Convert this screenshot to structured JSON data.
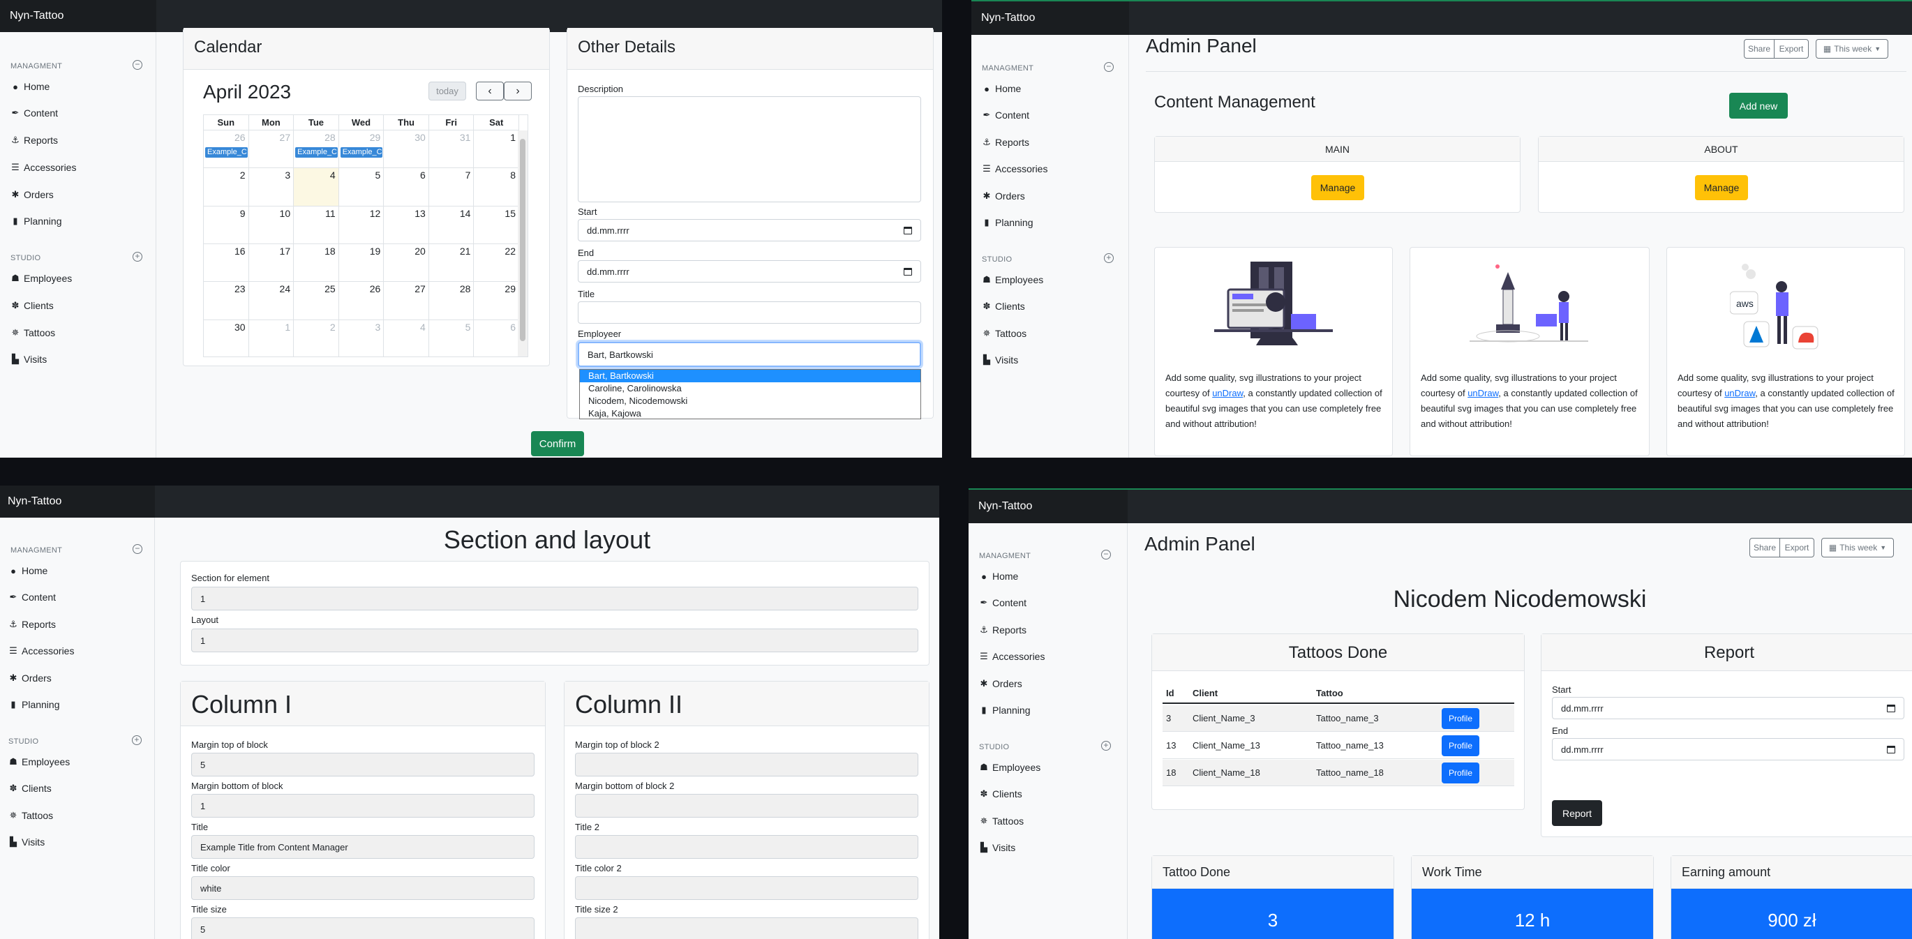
{
  "brand": "Nyn-Tattoo",
  "sidebar": {
    "section1": "MANAGMENT",
    "section2": "STUDIO",
    "items1": [
      {
        "label": "Home",
        "icon": "circle-icon"
      },
      {
        "label": "Content",
        "icon": "feather-icon"
      },
      {
        "label": "Reports",
        "icon": "anchor-icon"
      },
      {
        "label": "Accessories",
        "icon": "list-icon"
      },
      {
        "label": "Orders",
        "icon": "gear-icon"
      },
      {
        "label": "Planning",
        "icon": "book-icon"
      }
    ],
    "items2": [
      {
        "label": "Employees",
        "icon": "people-icon"
      },
      {
        "label": "Clients",
        "icon": "asterisk-icon"
      },
      {
        "label": "Tattoos",
        "icon": "spider-icon"
      },
      {
        "label": "Visits",
        "icon": "door-icon"
      }
    ]
  },
  "p1": {
    "calendar_title": "Calendar",
    "month": "April 2023",
    "today": "today",
    "days": [
      "Sun",
      "Mon",
      "Tue",
      "Wed",
      "Thu",
      "Fri",
      "Sat"
    ],
    "weeks": [
      [
        "26",
        "27",
        "28",
        "29",
        "30",
        "31",
        "1"
      ],
      [
        "2",
        "3",
        "4",
        "5",
        "6",
        "7",
        "8"
      ],
      [
        "9",
        "10",
        "11",
        "12",
        "13",
        "14",
        "15"
      ],
      [
        "16",
        "17",
        "18",
        "19",
        "20",
        "21",
        "22"
      ],
      [
        "23",
        "24",
        "25",
        "26",
        "27",
        "28",
        "29"
      ],
      [
        "30",
        "1",
        "2",
        "3",
        "4",
        "5",
        "6"
      ]
    ],
    "event": "Example_C",
    "details_title": "Other Details",
    "description": "Description",
    "start": "Start",
    "end": "End",
    "date_placeholder": "dd.mm.rrrr",
    "title": "Title",
    "employeer": "Employeer",
    "selected": "Bart, Bartkowski",
    "options": [
      "Bart, Bartkowski",
      "Caroline, Carolinowska",
      "Nicodem, Nicodemowski",
      "Kaja, Kajowa"
    ],
    "confirm": "Confirm"
  },
  "p2": {
    "title": "Admin Panel",
    "share": "Share",
    "export": "Export",
    "week": "This week",
    "cm": "Content Management",
    "add": "Add new",
    "main": "MAIN",
    "about": "ABOUT",
    "manage": "Manage",
    "card_pre": "Add some quality, svg illustrations to your project courtesy of ",
    "card_link": "unDraw",
    "card_post": ", a constantly updated collection of beautiful svg images that you can use completely free and without attribution!",
    "aws": "aws"
  },
  "p3": {
    "title": "Section and layout",
    "section_label": "Section for element",
    "section_val": "1",
    "layout_label": "Layout",
    "layout_val": "1",
    "col1": "Column I",
    "col2": "Column II",
    "c1": [
      {
        "l": "Margin top of block",
        "v": "5"
      },
      {
        "l": "Margin bottom of block",
        "v": "1"
      },
      {
        "l": "Title",
        "v": "Example Title from Content Manager"
      },
      {
        "l": "Title color",
        "v": "white"
      },
      {
        "l": "Title size",
        "v": "5"
      }
    ],
    "c2": [
      "Margin top of block 2",
      "Margin bottom of block 2",
      "Title 2",
      "Title color 2",
      "Title size 2"
    ]
  },
  "p4": {
    "title": "Admin Panel",
    "share": "Share",
    "export": "Export",
    "week": "This week",
    "name": "Nicodem Nicodemowski",
    "done_title": "Tattoos Done",
    "cols": [
      "Id",
      "Client",
      "Tattoo"
    ],
    "rows": [
      {
        "id": "3",
        "client": "Client_Name_3",
        "tattoo": "Tattoo_name_3"
      },
      {
        "id": "13",
        "client": "Client_Name_13",
        "tattoo": "Tattoo_name_13"
      },
      {
        "id": "18",
        "client": "Client_Name_18",
        "tattoo": "Tattoo_name_18"
      }
    ],
    "profile": "Profile",
    "report_title": "Report",
    "start": "Start",
    "end": "End",
    "date_placeholder": "dd.mm.rrrr",
    "report_btn": "Report",
    "stats": [
      {
        "label": "Tattoo Done",
        "value": "3"
      },
      {
        "label": "Work Time",
        "value": "12 h"
      },
      {
        "label": "Earning amount",
        "value": "900 zł"
      }
    ]
  }
}
